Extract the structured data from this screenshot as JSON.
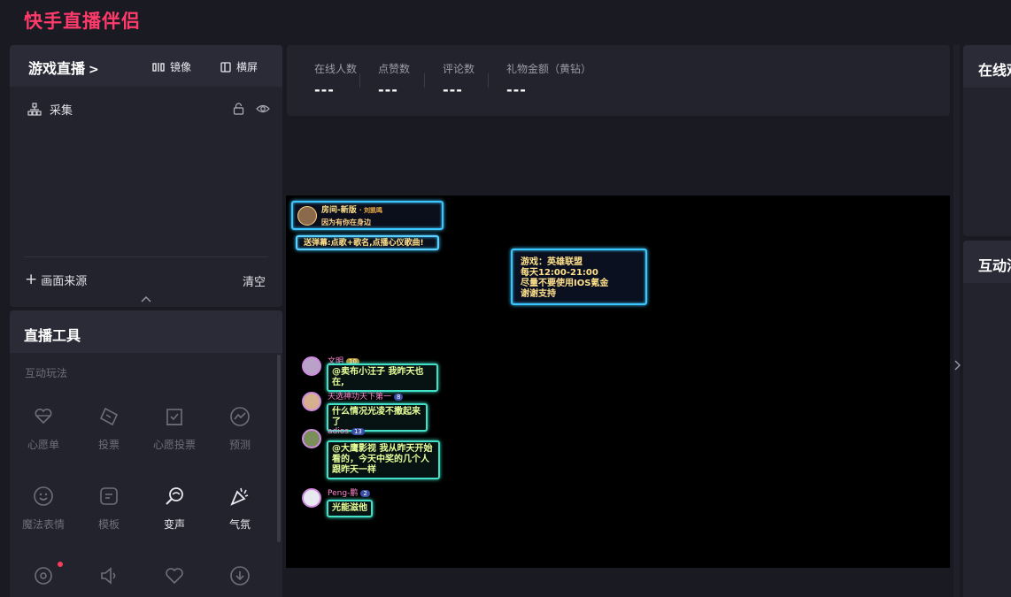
{
  "app": {
    "title": "快手直播伴侣"
  },
  "scene_panel": {
    "title": "游戏直播",
    "mirror_label": "镜像",
    "landscape_label": "横屏",
    "source_name": "采集",
    "add_source_label": "画面来源",
    "clear_label": "清空"
  },
  "tools_panel": {
    "title": "直播工具",
    "section_label": "互动玩法",
    "tools": [
      {
        "label": "心愿单",
        "icon": "heart-gift-icon"
      },
      {
        "label": "投票",
        "icon": "ticket-icon"
      },
      {
        "label": "心愿投票",
        "icon": "ballot-icon"
      },
      {
        "label": "预测",
        "icon": "trend-icon"
      },
      {
        "label": "魔法表情",
        "icon": "smile-icon"
      },
      {
        "label": "模板",
        "icon": "template-icon"
      },
      {
        "label": "变声",
        "icon": "voice-change-icon"
      },
      {
        "label": "气氛",
        "icon": "party-icon"
      }
    ]
  },
  "stats": {
    "online_label": "在线人数",
    "online_value": "---",
    "likes_label": "点赞数",
    "likes_value": "---",
    "comments_label": "评论数",
    "comments_value": "---",
    "gifts_label": "礼物金额（黄钻）",
    "gifts_value": "---"
  },
  "right_panels": {
    "top_title": "在线观众",
    "bottom_title": "互动消息"
  },
  "overlay": {
    "room_name": "房间-新版",
    "room_tag": "· 刘凯鸣",
    "room_sub": "因为有你在身边",
    "banner": "送弹幕:点歌+歌名,点播心仪歌曲!",
    "notice_lines": [
      "游戏：英雄联盟",
      "每天12:00-21:00",
      "尽量不要使用IOS氪金",
      "谢谢支持"
    ],
    "chats": [
      {
        "name": "文明",
        "level": "10",
        "text": "@卖布小汪子 我昨天也在,",
        "avatar_color": "#b9a2c8"
      },
      {
        "name": "天选神功天下第一",
        "level": "8",
        "text": "什么情况光凌不撒起来了",
        "avatar_color": "#d6b08e"
      },
      {
        "name": "adios",
        "level": "13",
        "text": "@大鹰影视 我从昨天开始看的，今天中奖的几个人跟昨天一样",
        "avatar_color": "#7a8f5a"
      },
      {
        "name": "Peng-鹏",
        "level": "2",
        "text": "光能滋他",
        "avatar_color": "#e8e8f0"
      }
    ]
  },
  "colors": {
    "brand": "#ff3b6b",
    "panel": "#23232d",
    "panel_header": "#2b2b38",
    "background": "#1a1a22"
  }
}
